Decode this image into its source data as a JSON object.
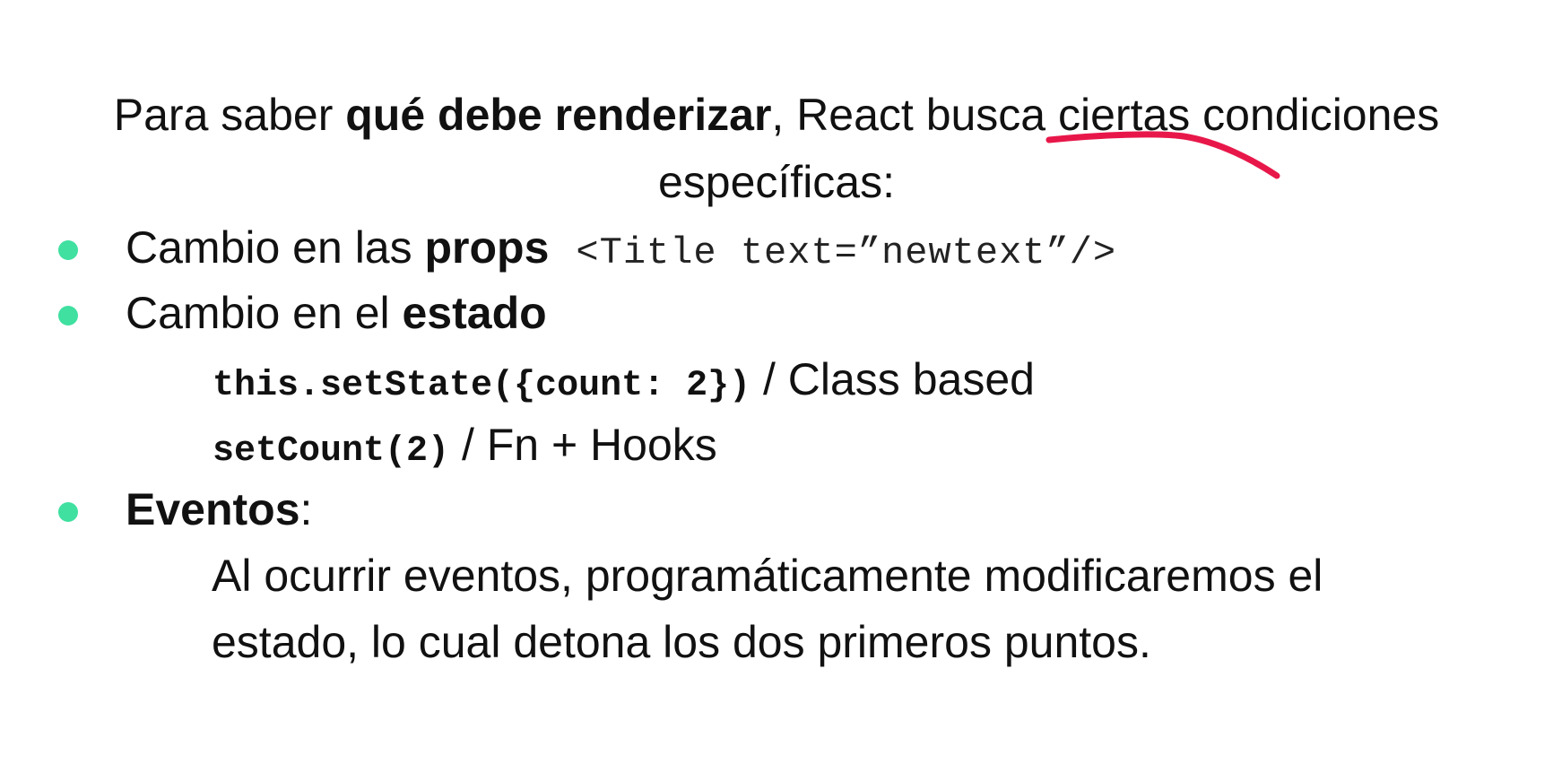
{
  "slide": {
    "title": {
      "line1_pre": "Para saber ",
      "line1_bold": "qué debe renderizar",
      "line1_post": ", React busca ciertas condiciones",
      "line2": "específicas:"
    },
    "bullets": [
      {
        "text": "Cambio en las ",
        "bold": "props",
        "code": "<Title text=”newtext”/>"
      },
      {
        "text": "Cambio en el ",
        "bold": "estado",
        "examples": [
          {
            "code": "this.setState({count: 2})",
            "label": " / Class based"
          },
          {
            "code": "setCount(2)",
            "label": " / Fn + Hooks"
          }
        ]
      },
      {
        "bold": "Eventos",
        "text": ":",
        "description": [
          "Al ocurrir eventos, programáticamente modificaremos el",
          "estado, lo cual detona los dos primeros puntos."
        ]
      }
    ]
  },
  "colors": {
    "bullet": "#3fe0a0",
    "annotation": "#e8174a",
    "text": "#111111"
  },
  "icons": {
    "bullet": "green-dot-bullet",
    "annotation": "red-pen-stroke"
  }
}
